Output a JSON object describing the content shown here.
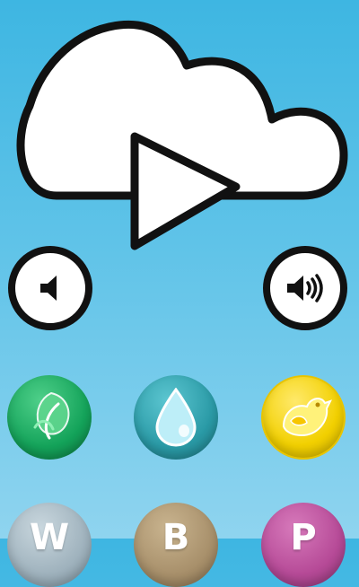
{
  "colors": {
    "background_top": "#3eb6e2",
    "background_bottom": "#8fd4ef",
    "outline": "#111111",
    "nature": "#14a35a",
    "water": "#33a7b3",
    "bird": "#f2d000",
    "w_button": "#9fb2bd",
    "b_button": "#a8906b",
    "p_button": "#b64a97"
  },
  "icons": {
    "cloud_play": "cloud-play-icon",
    "volume_down": "volume-down-icon",
    "volume_up": "volume-up-icon",
    "nature": "leaf-icon",
    "water": "water-drop-icon",
    "bird": "bird-icon"
  },
  "sound_buttons": {
    "row2": {
      "w_label": "W",
      "b_label": "B",
      "p_label": "P"
    }
  }
}
